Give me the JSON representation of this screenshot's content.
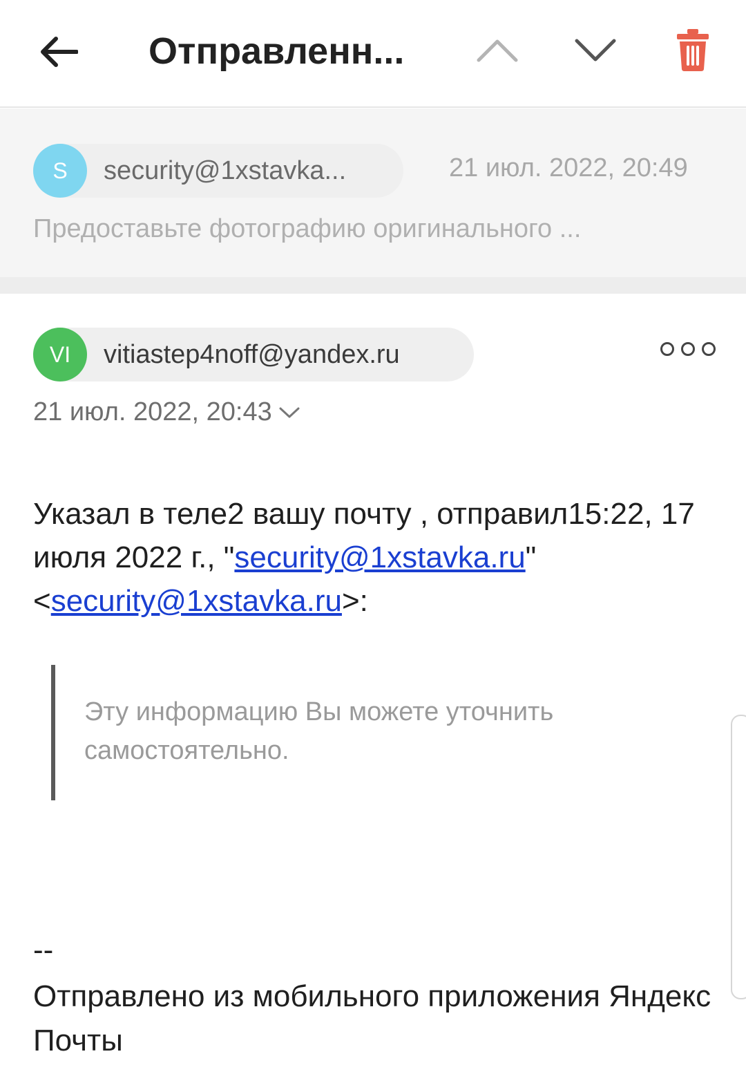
{
  "header": {
    "title": "Отправленн..."
  },
  "previous_message": {
    "avatar_letter": "S",
    "avatar_color": "#7fd6f0",
    "sender": "security@1xstavka...",
    "date": "21 июл. 2022, 20:49",
    "snippet": "Предоставьте фотографию оригинального ..."
  },
  "message": {
    "avatar_letter": "VI",
    "avatar_color": "#4cbf5c",
    "sender": "vitiastep4noff@yandex.ru",
    "date": "21 июл. 2022, 20:43",
    "body_part1": "Указал в теле2 вашу почту , отправил15:22, 17 июля 2022 г., \"",
    "link1": "security@1xstavka.ru",
    "body_part2": "\" <",
    "link2": "security@1xstavka.ru",
    "body_part3": ">:",
    "quote": "Эту информацию Вы можете уточнить самостоятельно.",
    "signature_dash": "--",
    "signature": "Отправлено из мобильного приложения Яндекс Почты"
  },
  "colors": {
    "delete_icon": "#e8614d",
    "link": "#1a3fd1"
  }
}
